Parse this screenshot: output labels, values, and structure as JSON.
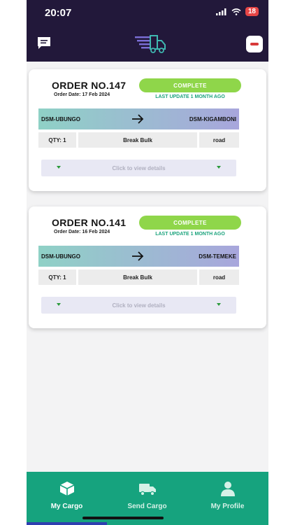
{
  "status_bar": {
    "time": "20:07",
    "battery": "18"
  },
  "header": {
    "chat_icon": "chat-icon",
    "logo_icon": "delivery-truck-logo-icon",
    "profile_icon": "profile-thumbnail"
  },
  "orders": [
    {
      "order_no": "ORDER NO.147",
      "order_date": "Order Date: 17 Feb 2024",
      "status": "COMPLETE",
      "last_update": "LAST UPDATE 1 MONTH AGO",
      "from": "DSM-UBUNGO",
      "to": "DSM-KIGAMBONI",
      "qty": "QTY: 1",
      "cargo_type": "Break Bulk",
      "mode": "road",
      "details_label": "Click to view details"
    },
    {
      "order_no": "ORDER NO.141",
      "order_date": "Order Date: 16 Feb 2024",
      "status": "COMPLETE",
      "last_update": "LAST UPDATE 1 MONTH AGO",
      "from": "DSM-UBUNGO",
      "to": "DSM-TEMEKE",
      "qty": "QTY: 1",
      "cargo_type": "Break Bulk",
      "mode": "road",
      "details_label": "Click to view details"
    }
  ],
  "bottom_nav": {
    "items": [
      {
        "label": "My Cargo",
        "icon": "box-icon",
        "active": true
      },
      {
        "label": "Send Cargo",
        "icon": "truck-icon",
        "active": false
      },
      {
        "label": "My Profile",
        "icon": "person-icon",
        "active": false
      }
    ]
  },
  "colors": {
    "header_bg": "#22183a",
    "nav_bg": "#16a37e",
    "status_green": "#8fd64a",
    "accent_teal": "#1aa37c"
  }
}
